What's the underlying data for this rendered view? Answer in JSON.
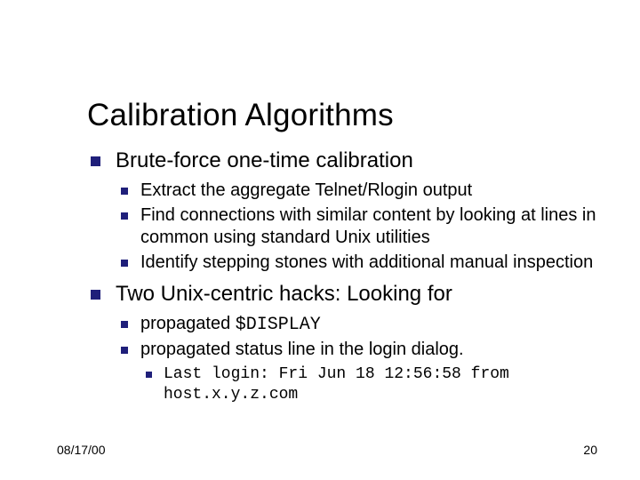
{
  "title": "Calibration Algorithms",
  "bullets": {
    "b1": "Brute-force one-time calibration",
    "b1_1": "Extract the aggregate Telnet/Rlogin output",
    "b1_2": "Find connections with similar content by looking at lines in common using standard Unix utilities",
    "b1_3": "Identify stepping stones with additional manual inspection",
    "b2": "Two Unix-centric hacks: Looking for",
    "b2_1_pre": "propagated ",
    "b2_1_code": "$DISPLAY",
    "b2_2": "propagated status line in the login dialog.",
    "b2_2_1": "Last login: Fri Jun 18 12:56:58 from host.x.y.z.com"
  },
  "footer": {
    "date": "08/17/00",
    "page": "20"
  }
}
